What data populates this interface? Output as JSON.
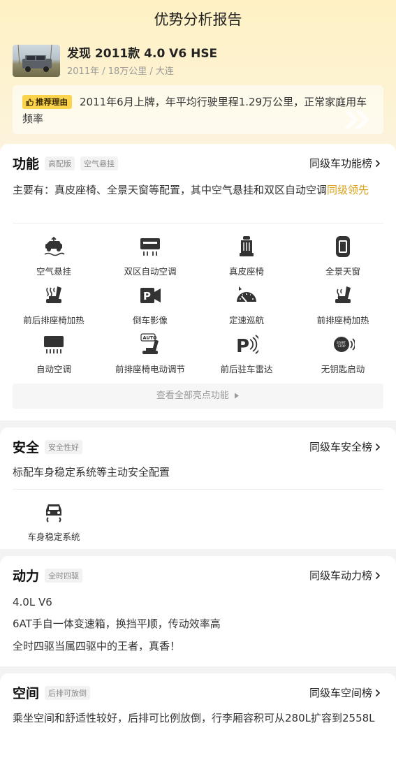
{
  "header": {
    "title": "优势分析报告"
  },
  "car": {
    "name": "发现 2011款 4.0 V6 HSE",
    "meta": "2011年 / 18万公里 / 大连"
  },
  "reason": {
    "badge": "推荐理由",
    "text": "2011年6月上牌，年平均行驶里程1.29万公里，正常家庭用车频率"
  },
  "function": {
    "title": "功能",
    "tags": [
      "高配版",
      "空气悬挂"
    ],
    "rank_link": "同级车功能榜",
    "summary_prefix": "主要有：真皮座椅、全景天窗等配置，其中空气悬挂和双区自动空调",
    "summary_highlight": "同级领先",
    "features": [
      {
        "label": "空气悬挂",
        "icon": "air-suspension-icon"
      },
      {
        "label": "双区自动空调",
        "icon": "dual-zone-ac-icon"
      },
      {
        "label": "真皮座椅",
        "icon": "leather-seat-icon"
      },
      {
        "label": "全景天窗",
        "icon": "panoramic-sunroof-icon"
      },
      {
        "label": "前后排座椅加热",
        "icon": "seat-heating-icon"
      },
      {
        "label": "倒车影像",
        "icon": "reverse-camera-icon"
      },
      {
        "label": "定速巡航",
        "icon": "cruise-control-icon"
      },
      {
        "label": "前排座椅加热",
        "icon": "front-seat-heating-icon"
      },
      {
        "label": "自动空调",
        "icon": "auto-ac-icon"
      },
      {
        "label": "前排座椅电动调节",
        "icon": "power-seat-icon"
      },
      {
        "label": "前后驻车雷达",
        "icon": "parking-radar-icon"
      },
      {
        "label": "无钥匙启动",
        "icon": "keyless-start-icon"
      }
    ],
    "view_all": "查看全部亮点功能"
  },
  "safety": {
    "title": "安全",
    "tag": "安全性好",
    "rank_link": "同级车安全榜",
    "summary": "标配车身稳定系统等主动安全配置",
    "features": [
      {
        "label": "车身稳定系统",
        "icon": "esp-icon"
      }
    ]
  },
  "power": {
    "title": "动力",
    "tag": "全时四驱",
    "rank_link": "同级车动力榜",
    "lines": [
      "4.0L V6",
      "6AT手自一体变速箱，换挡平顺，传动效率高",
      "全时四驱当属四驱中的王者，真香！"
    ]
  },
  "space": {
    "title": "空间",
    "tag": "后排可放倒",
    "rank_link": "同级车空间榜",
    "summary": "乘坐空间和舒适性较好，后排可比例放倒，行李厢容积可从280L扩容到2558L"
  },
  "colors": {
    "accent": "#d9a21b",
    "badge": "#fcd34d",
    "hero_bg": "#fff1c4"
  }
}
